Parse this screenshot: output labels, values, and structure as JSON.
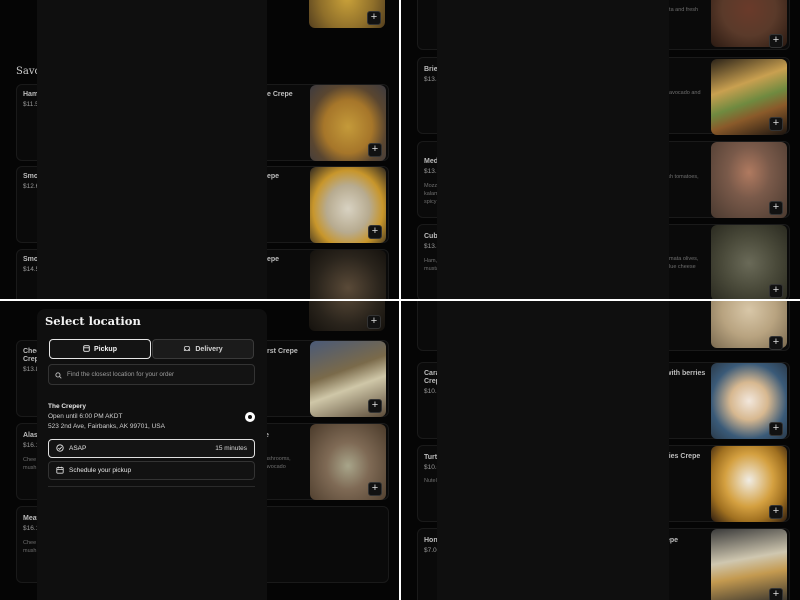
{
  "top_left": {
    "section_title": "Savo",
    "items": [
      {
        "name": "Ham",
        "price": "$11.5",
        "desc": "",
        "name_right": "e Crepe",
        "desc_right": ""
      },
      {
        "name": "Smo",
        "price": "$12.6",
        "desc": "",
        "name_right": "epe",
        "desc_right": ""
      },
      {
        "name": "Smo",
        "price": "$14.5",
        "desc": "",
        "name_right": "epe",
        "desc_right": ""
      }
    ]
  },
  "top_right": {
    "items": [
      {
        "name": "",
        "price": "",
        "desc": "",
        "name_right": "",
        "desc_right": "ata and fresh"
      },
      {
        "name": "Brie",
        "price": "$13.8",
        "desc": "",
        "name_right": "",
        "desc_right": ", avocado and"
      },
      {
        "name": "Medi",
        "price": "$13.9",
        "desc": "Mozz kalam spicy",
        "name_right": "",
        "desc_right": "ish tomatoes,"
      },
      {
        "name": "Cuba",
        "price": "$13.8",
        "desc": "Ham, musta",
        "name_right": "",
        "desc_right": "amata olives, blue cheese"
      }
    ]
  },
  "bottom_left": {
    "items": [
      {
        "name": "Chee Crepe",
        "price": "$13.8",
        "desc": "",
        "name_right": "twurst Crepe",
        "desc_right": ""
      },
      {
        "name": "Alask",
        "price": "$16.1",
        "desc": "Chee mush",
        "name_right": "e",
        "desc_right": "ushrooms, avocado"
      },
      {
        "name": "Meat",
        "price": "$16.1",
        "desc": "Chee mush",
        "name_right": "",
        "desc_right": ""
      }
    ],
    "modal": {
      "title": "Select location",
      "tabs": [
        {
          "label": "Pickup",
          "icon": "store-icon",
          "selected": true
        },
        {
          "label": "Delivery",
          "icon": "car-icon",
          "selected": false
        }
      ],
      "search_placeholder": "Find the closest location for your order",
      "location": {
        "name": "The Crepery",
        "hours": "Open until 6:00 PM AKDT",
        "address": "523 2nd Ave, Fairbanks, AK 99701, USA",
        "selected": true
      },
      "options": [
        {
          "label": "ASAP",
          "right": "15 minutes",
          "icon": "check-circle-icon",
          "selected": true
        },
        {
          "label": "Schedule your pickup",
          "right": "",
          "icon": "calendar-icon",
          "selected": false
        }
      ]
    }
  },
  "bottom_right": {
    "items": [
      {
        "name": "Cara Crep",
        "price": "$10.5",
        "desc": "",
        "name_right": "with berries",
        "desc_right": ""
      },
      {
        "name": "Turtl",
        "price": "$10.0",
        "desc": "Nutel",
        "name_right": "ries Crepe",
        "desc_right": ""
      },
      {
        "name": "Hone",
        "price": "$7.00",
        "desc": "",
        "name_right": "epe",
        "desc_right": ""
      }
    ]
  },
  "add_label": "+",
  "colors": {
    "background": "#050505",
    "panel": "#0f0f0f",
    "accent": "#ffffff"
  }
}
